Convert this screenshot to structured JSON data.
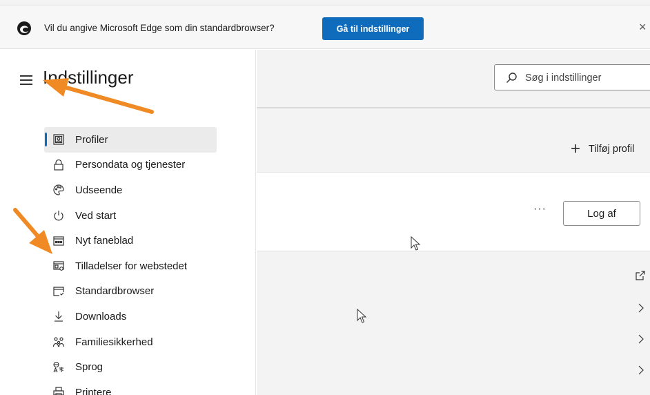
{
  "banner": {
    "message": "Vil du angive Microsoft Edge som din standardbrowser?",
    "button_label": "Gå til indstillinger",
    "close_glyph": "×"
  },
  "sidebar": {
    "title": "Indstillinger",
    "items": [
      {
        "label": "Profiler",
        "icon": "profile-icon",
        "active": true
      },
      {
        "label": "Persondata og tjenester",
        "icon": "lock-icon"
      },
      {
        "label": "Udseende",
        "icon": "palette-icon"
      },
      {
        "label": "Ved start",
        "icon": "power-icon"
      },
      {
        "label": "Nyt faneblad",
        "icon": "new-tab-icon"
      },
      {
        "label": "Tilladelser for webstedet",
        "icon": "site-permissions-icon"
      },
      {
        "label": "Standardbrowser",
        "icon": "default-browser-icon"
      },
      {
        "label": "Downloads",
        "icon": "download-icon"
      },
      {
        "label": "Familiesikkerhed",
        "icon": "family-icon"
      },
      {
        "label": "Sprog",
        "icon": "language-icon"
      },
      {
        "label": "Printere",
        "icon": "printer-icon"
      }
    ]
  },
  "main": {
    "search_placeholder": "Søg i indstillinger",
    "add_profile_label": "Tilføj profil",
    "more_glyph": "···",
    "logout_label": "Log af"
  },
  "colors": {
    "accent": "#0f6cbd",
    "annotation_arrow": "#f08a24"
  }
}
